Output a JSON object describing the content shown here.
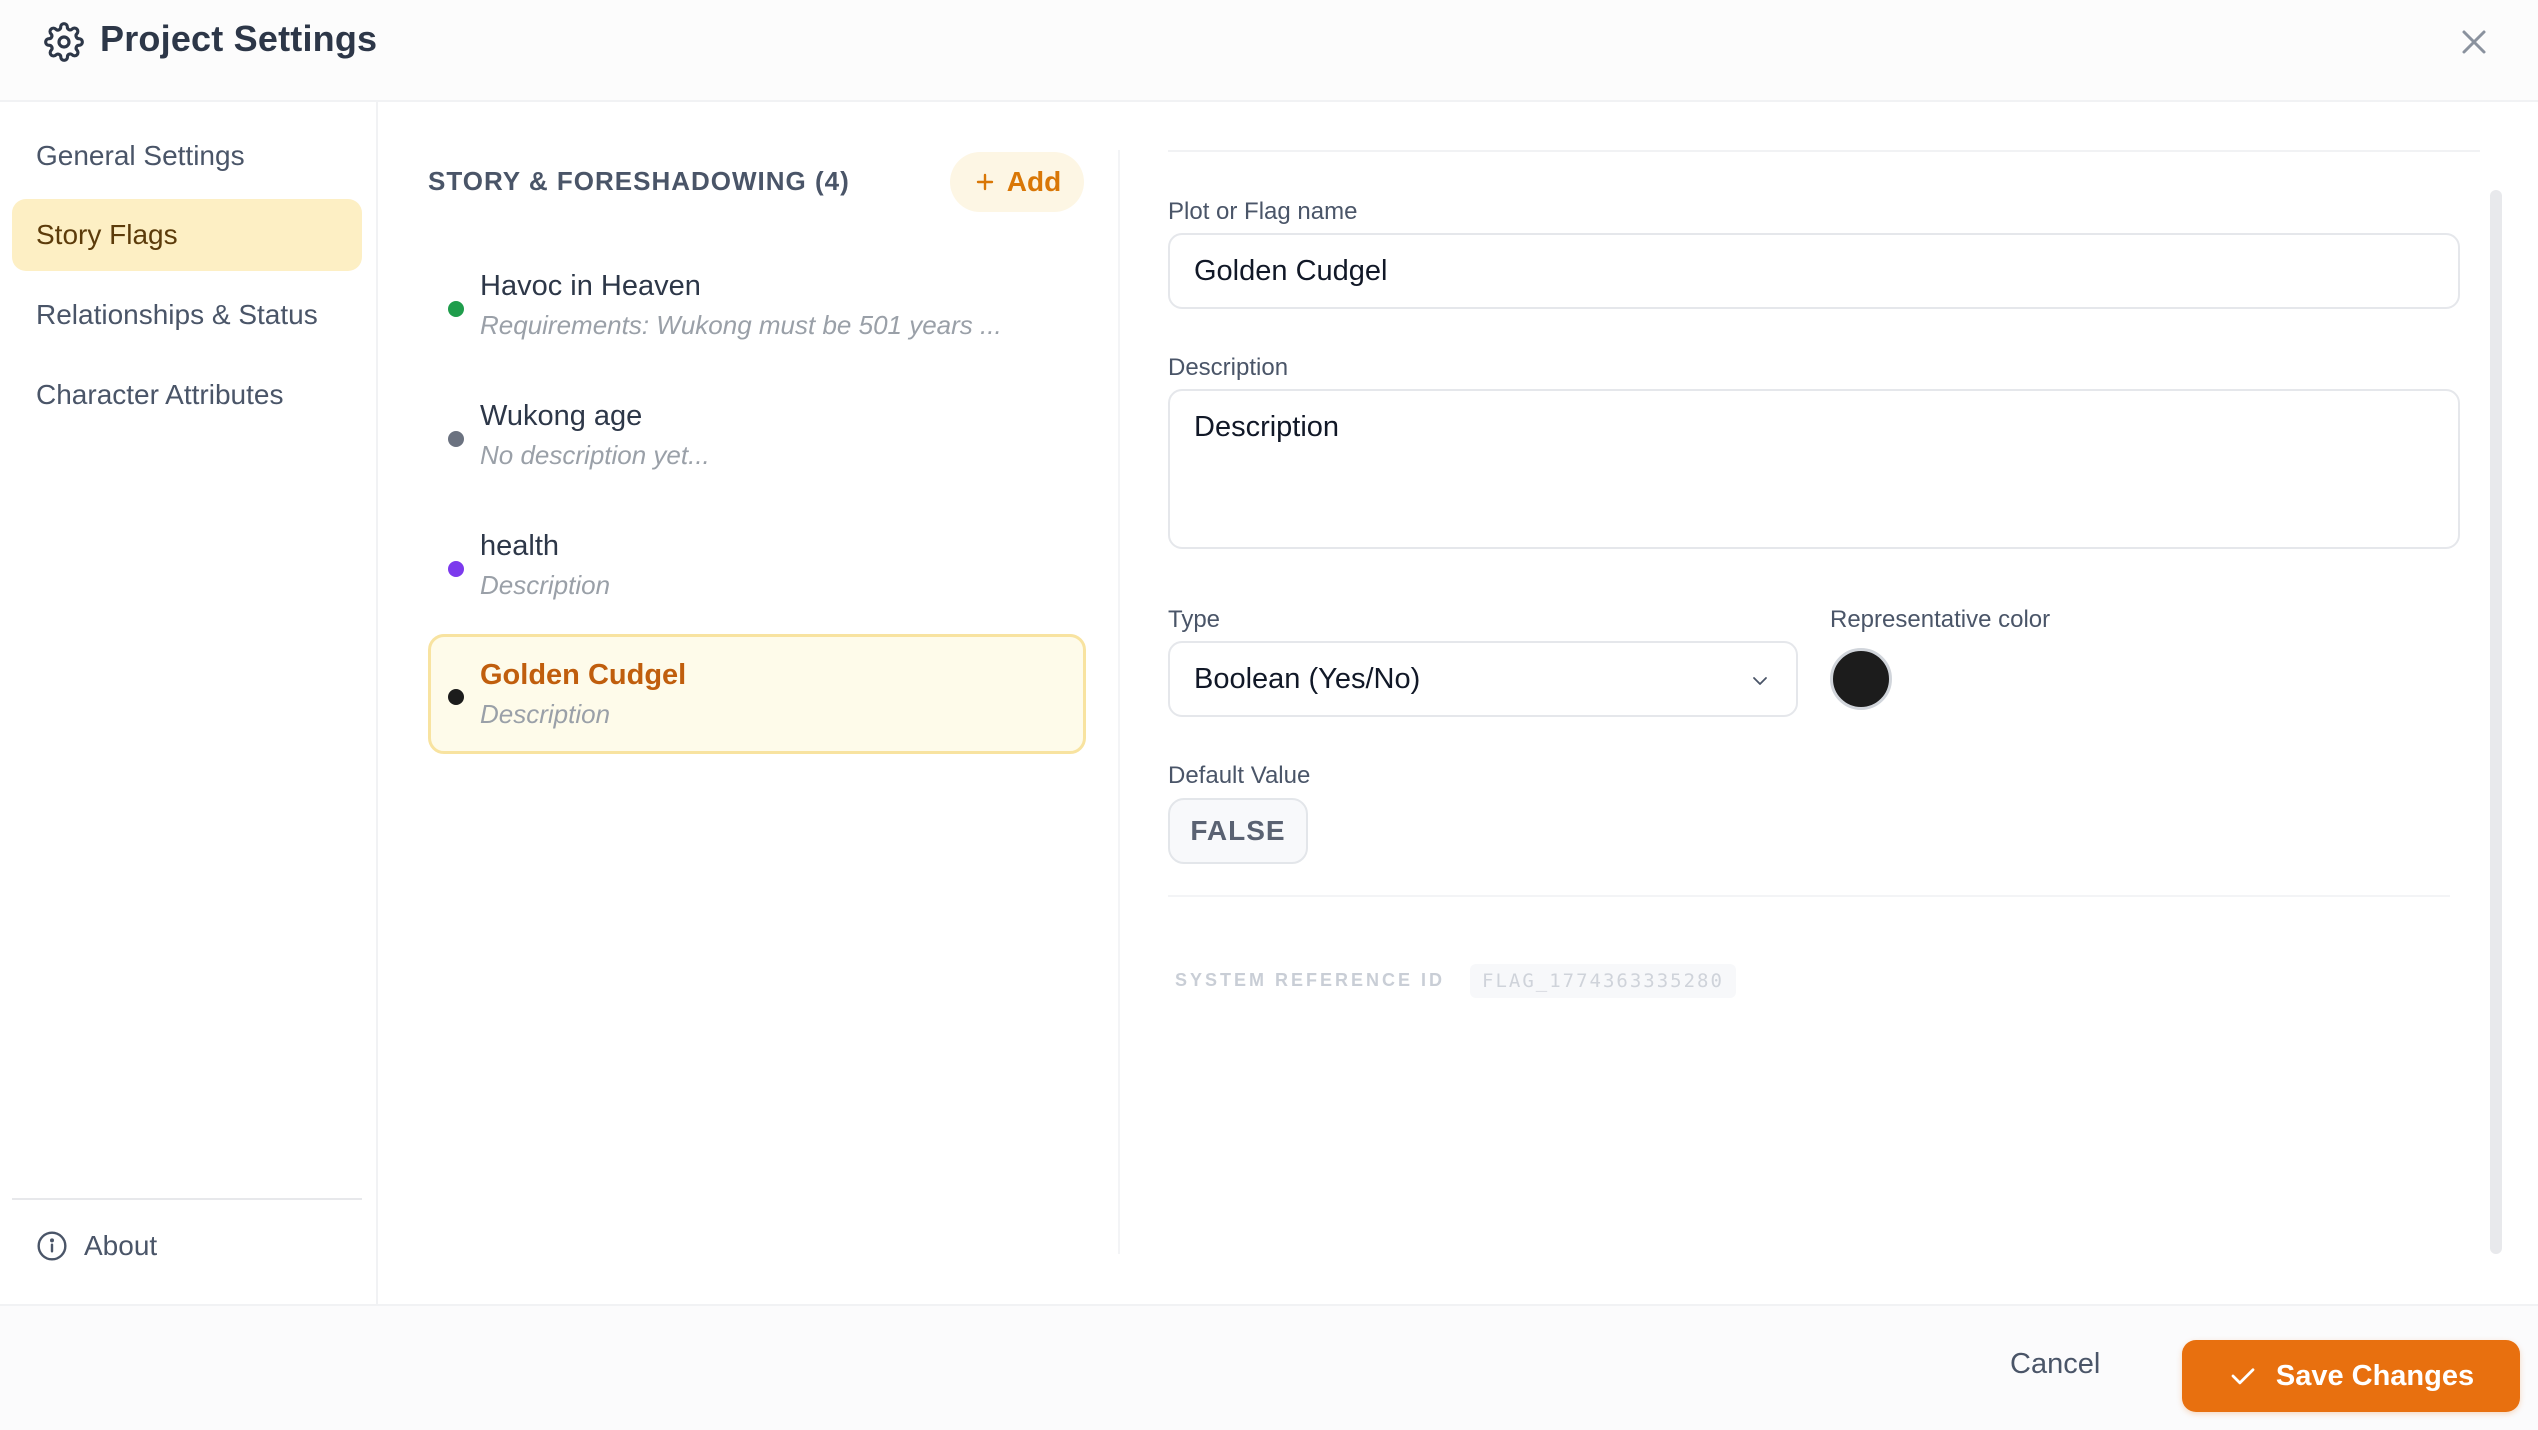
{
  "header": {
    "title": "Project Settings",
    "icon": "gear-icon",
    "close_icon": "close-icon"
  },
  "sidebar": {
    "items": [
      {
        "label": "General Settings",
        "active": false
      },
      {
        "label": "Story Flags",
        "active": true
      },
      {
        "label": "Relationships & Status",
        "active": false
      },
      {
        "label": "Character Attributes",
        "active": false
      }
    ],
    "about_label": "About",
    "about_icon": "info-icon"
  },
  "list": {
    "title": "STORY & FORESHADOWING (4)",
    "add_label": "Add",
    "flags": [
      {
        "name": "Havoc in Heaven",
        "description": "Requirements: Wukong must be 501 years ...",
        "color": "#1f9d4c",
        "selected": false
      },
      {
        "name": "Wukong age",
        "description": "No description yet...",
        "color": "#6b7280",
        "selected": false
      },
      {
        "name": "health",
        "description": "Description",
        "color": "#7c3aed",
        "selected": false
      },
      {
        "name": "Golden Cudgel",
        "description": "Description",
        "color": "#1c1c1c",
        "selected": true
      }
    ]
  },
  "detail": {
    "name_label": "Plot or Flag name",
    "name_value": "Golden Cudgel",
    "description_label": "Description",
    "description_value": "Description",
    "type_label": "Type",
    "type_value": "Boolean (Yes/No)",
    "color_label": "Representative color",
    "color_value": "#1c1c1c",
    "default_label": "Default Value",
    "default_value": "FALSE",
    "sysref_label": "SYSTEM REFERENCE ID",
    "sysref_value": "FLAG_1774363335280"
  },
  "footer": {
    "cancel_label": "Cancel",
    "save_label": "Save Changes",
    "save_color": "#e8700f"
  }
}
